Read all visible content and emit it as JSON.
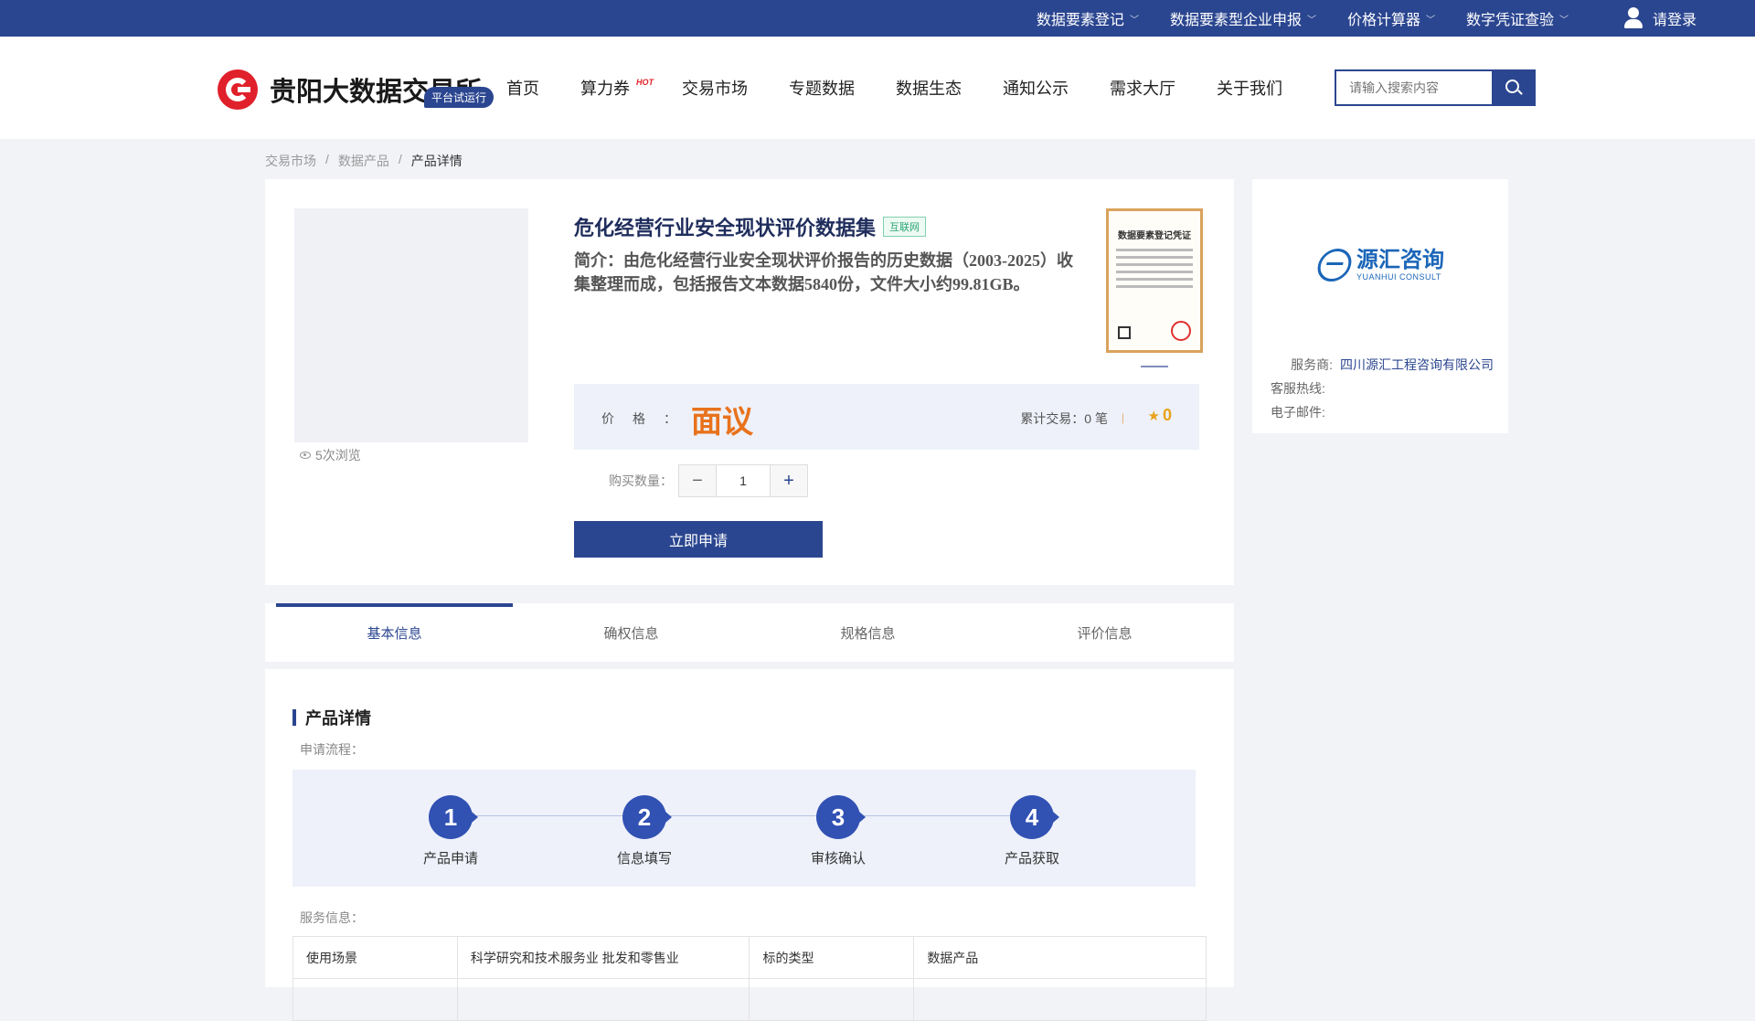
{
  "topbar": {
    "links": [
      {
        "label": "数据要素登记"
      },
      {
        "label": "数据要素型企业申报"
      },
      {
        "label": "价格计算器"
      },
      {
        "label": "数字凭证查验"
      }
    ],
    "login_label": "请登录"
  },
  "header": {
    "logo_text": "贵阳大数据交易所",
    "trial_badge": "平台试运行",
    "nav": [
      {
        "label": "首页"
      },
      {
        "label": "算力券",
        "hot": "HOT"
      },
      {
        "label": "交易市场"
      },
      {
        "label": "专题数据"
      },
      {
        "label": "数据生态"
      },
      {
        "label": "通知公示"
      },
      {
        "label": "需求大厅"
      },
      {
        "label": "关于我们"
      }
    ],
    "search_placeholder": "请输入搜索内容"
  },
  "breadcrumb": [
    "交易市场",
    "数据产品",
    "产品详情"
  ],
  "breadcrumb_sep": "/",
  "product": {
    "title": "危化经营行业安全现状评价数据集",
    "tag": "互联网",
    "description": "简介：由危化经营行业安全现状评价报告的历史数据（2003-2025）收集整理而成，包括报告文本数据5840份，文件大小约99.81GB。",
    "views": "5次浏览",
    "certificate_title": "数据要素登记凭证",
    "price_label": "价格：",
    "price_value": "面议",
    "trade_count": "累计交易：0 笔",
    "divider": "|",
    "rating": "0",
    "qty_label": "购买数量：",
    "qty_minus": "−",
    "qty_value": "1",
    "qty_plus": "+",
    "apply_label": "立即申请"
  },
  "provider": {
    "logo_cn": "源汇咨询",
    "logo_en": "YUANHUI CONSULT",
    "service_label": "服务商:",
    "service_value": "四川源汇工程咨询有限公司",
    "hotline_label": "客服热线:",
    "hotline_value": "",
    "email_label": "电子邮件:",
    "email_value": ""
  },
  "tabs": [
    {
      "label": "基本信息",
      "active": true
    },
    {
      "label": "确权信息"
    },
    {
      "label": "规格信息"
    },
    {
      "label": "评价信息"
    }
  ],
  "detail": {
    "section_title": "产品详情",
    "flow_label": "申请流程：",
    "steps": [
      {
        "num": "1",
        "label": "产品申请"
      },
      {
        "num": "2",
        "label": "信息填写"
      },
      {
        "num": "3",
        "label": "审核确认"
      },
      {
        "num": "4",
        "label": "产品获取"
      }
    ],
    "service_label": "服务信息：",
    "table": [
      [
        "使用场景",
        "科学研究和技术服务业 批发和零售业",
        "标的类型",
        "数据产品"
      ],
      [
        "",
        "",
        "",
        ""
      ]
    ]
  },
  "colors": {
    "brand": "#2b4690",
    "price": "#e8721c",
    "logo_red": "#e0202a"
  }
}
